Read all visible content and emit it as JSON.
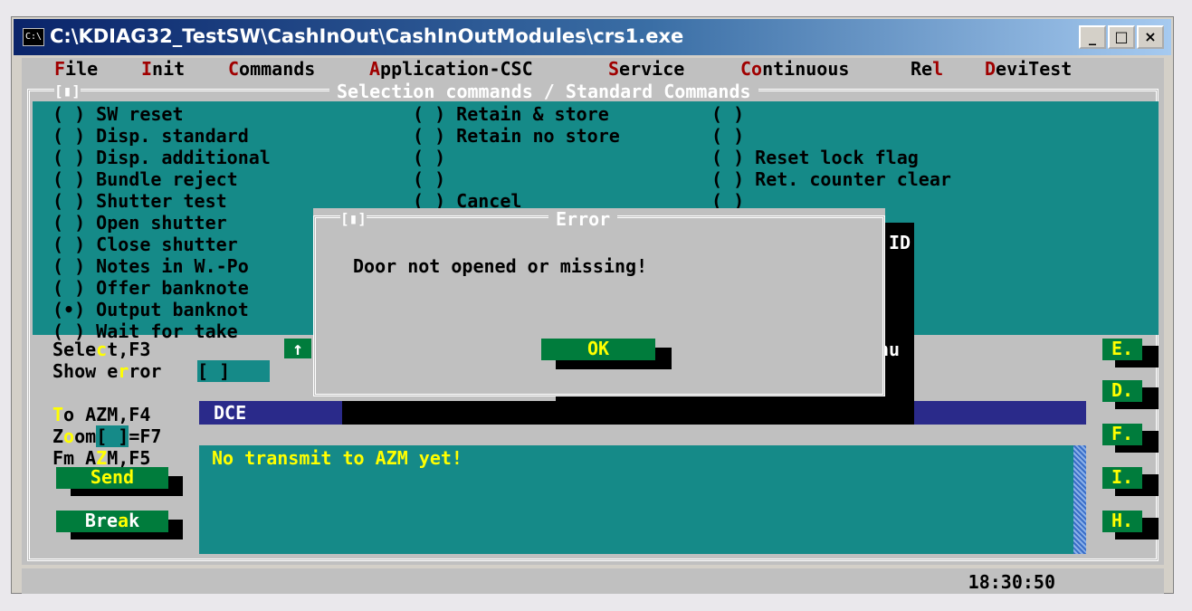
{
  "window": {
    "title": "C:\\KDIAG32_TestSW\\CashInOut\\CashInOutModules\\crs1.exe",
    "icon": "console-icon",
    "buttons": [
      "_",
      "□",
      "×"
    ]
  },
  "menu": [
    {
      "hot": "F",
      "rest": "ile"
    },
    {
      "hot": "I",
      "rest": "nit"
    },
    {
      "hot": "C",
      "rest": "ommands"
    },
    {
      "hot": "A",
      "rest": "pplication-CSC"
    },
    {
      "hot": "S",
      "rest": "ervice"
    },
    {
      "hot": "Co",
      "rest": "ntinuous"
    },
    {
      "pre": "Re",
      "hot": "l",
      "rest": ""
    },
    {
      "hot": "D",
      "rest": "eviTest"
    }
  ],
  "group": {
    "title": "Selection commands / Standard Commands",
    "button": "[▮]"
  },
  "col1": [
    "( ) SW reset",
    "( ) Disp. standard",
    "( ) Disp. additional",
    "( ) Bundle reject",
    "( ) Shutter test",
    "( ) Open shutter",
    "( ) Close shutter",
    "( ) Notes in W.-Po",
    "( ) Offer banknote",
    "(•) Output banknot",
    "( ) Wait for take"
  ],
  "col2": [
    "( ) Retain & store",
    "( ) Retain no store",
    "( )",
    "( )",
    "( ) Cancel"
  ],
  "col3": [
    "( )",
    "( )",
    "( ) Reset lock flag",
    "( ) Ret. counter clear",
    "( )"
  ],
  "partial": {
    "id": "ID",
    "nu": "nu"
  },
  "controls": {
    "select": {
      "pre": "Sele",
      "hot": "c",
      "rest": "t,F3"
    },
    "show_error": {
      "pre": "Show e",
      "hot": "r",
      "rest": "ror"
    },
    "show_error_box": "[ ]",
    "to_azm": {
      "hot": "T",
      "rest": "o AZM,F4"
    },
    "zoom": {
      "pre": "Z",
      "hot": "o",
      "rest": "om"
    },
    "zoom_box": "[ ]",
    "zoom_key": "=F7",
    "fm_azm": {
      "pre": "Fm A",
      "hot": "Z",
      "rest": "M,F5"
    },
    "send": "Send",
    "break": {
      "pre": "Bre",
      "hot": "a",
      "rest": "k"
    },
    "arrow": "↑"
  },
  "side_buttons": [
    "E.",
    "D.",
    "F.",
    "I.",
    "H."
  ],
  "dce_label": "DCE",
  "message": "No transmit to AZM yet!",
  "error": {
    "title": "Error",
    "button": "[▮]",
    "message": "Door not opened or missing!",
    "ok": "OK"
  },
  "status": {
    "time": "18:30:50"
  },
  "colors": {
    "teal": "#158a88",
    "green_button": "#007c3c",
    "navy": "#2a2a8a",
    "hotkey": "#a00000"
  }
}
